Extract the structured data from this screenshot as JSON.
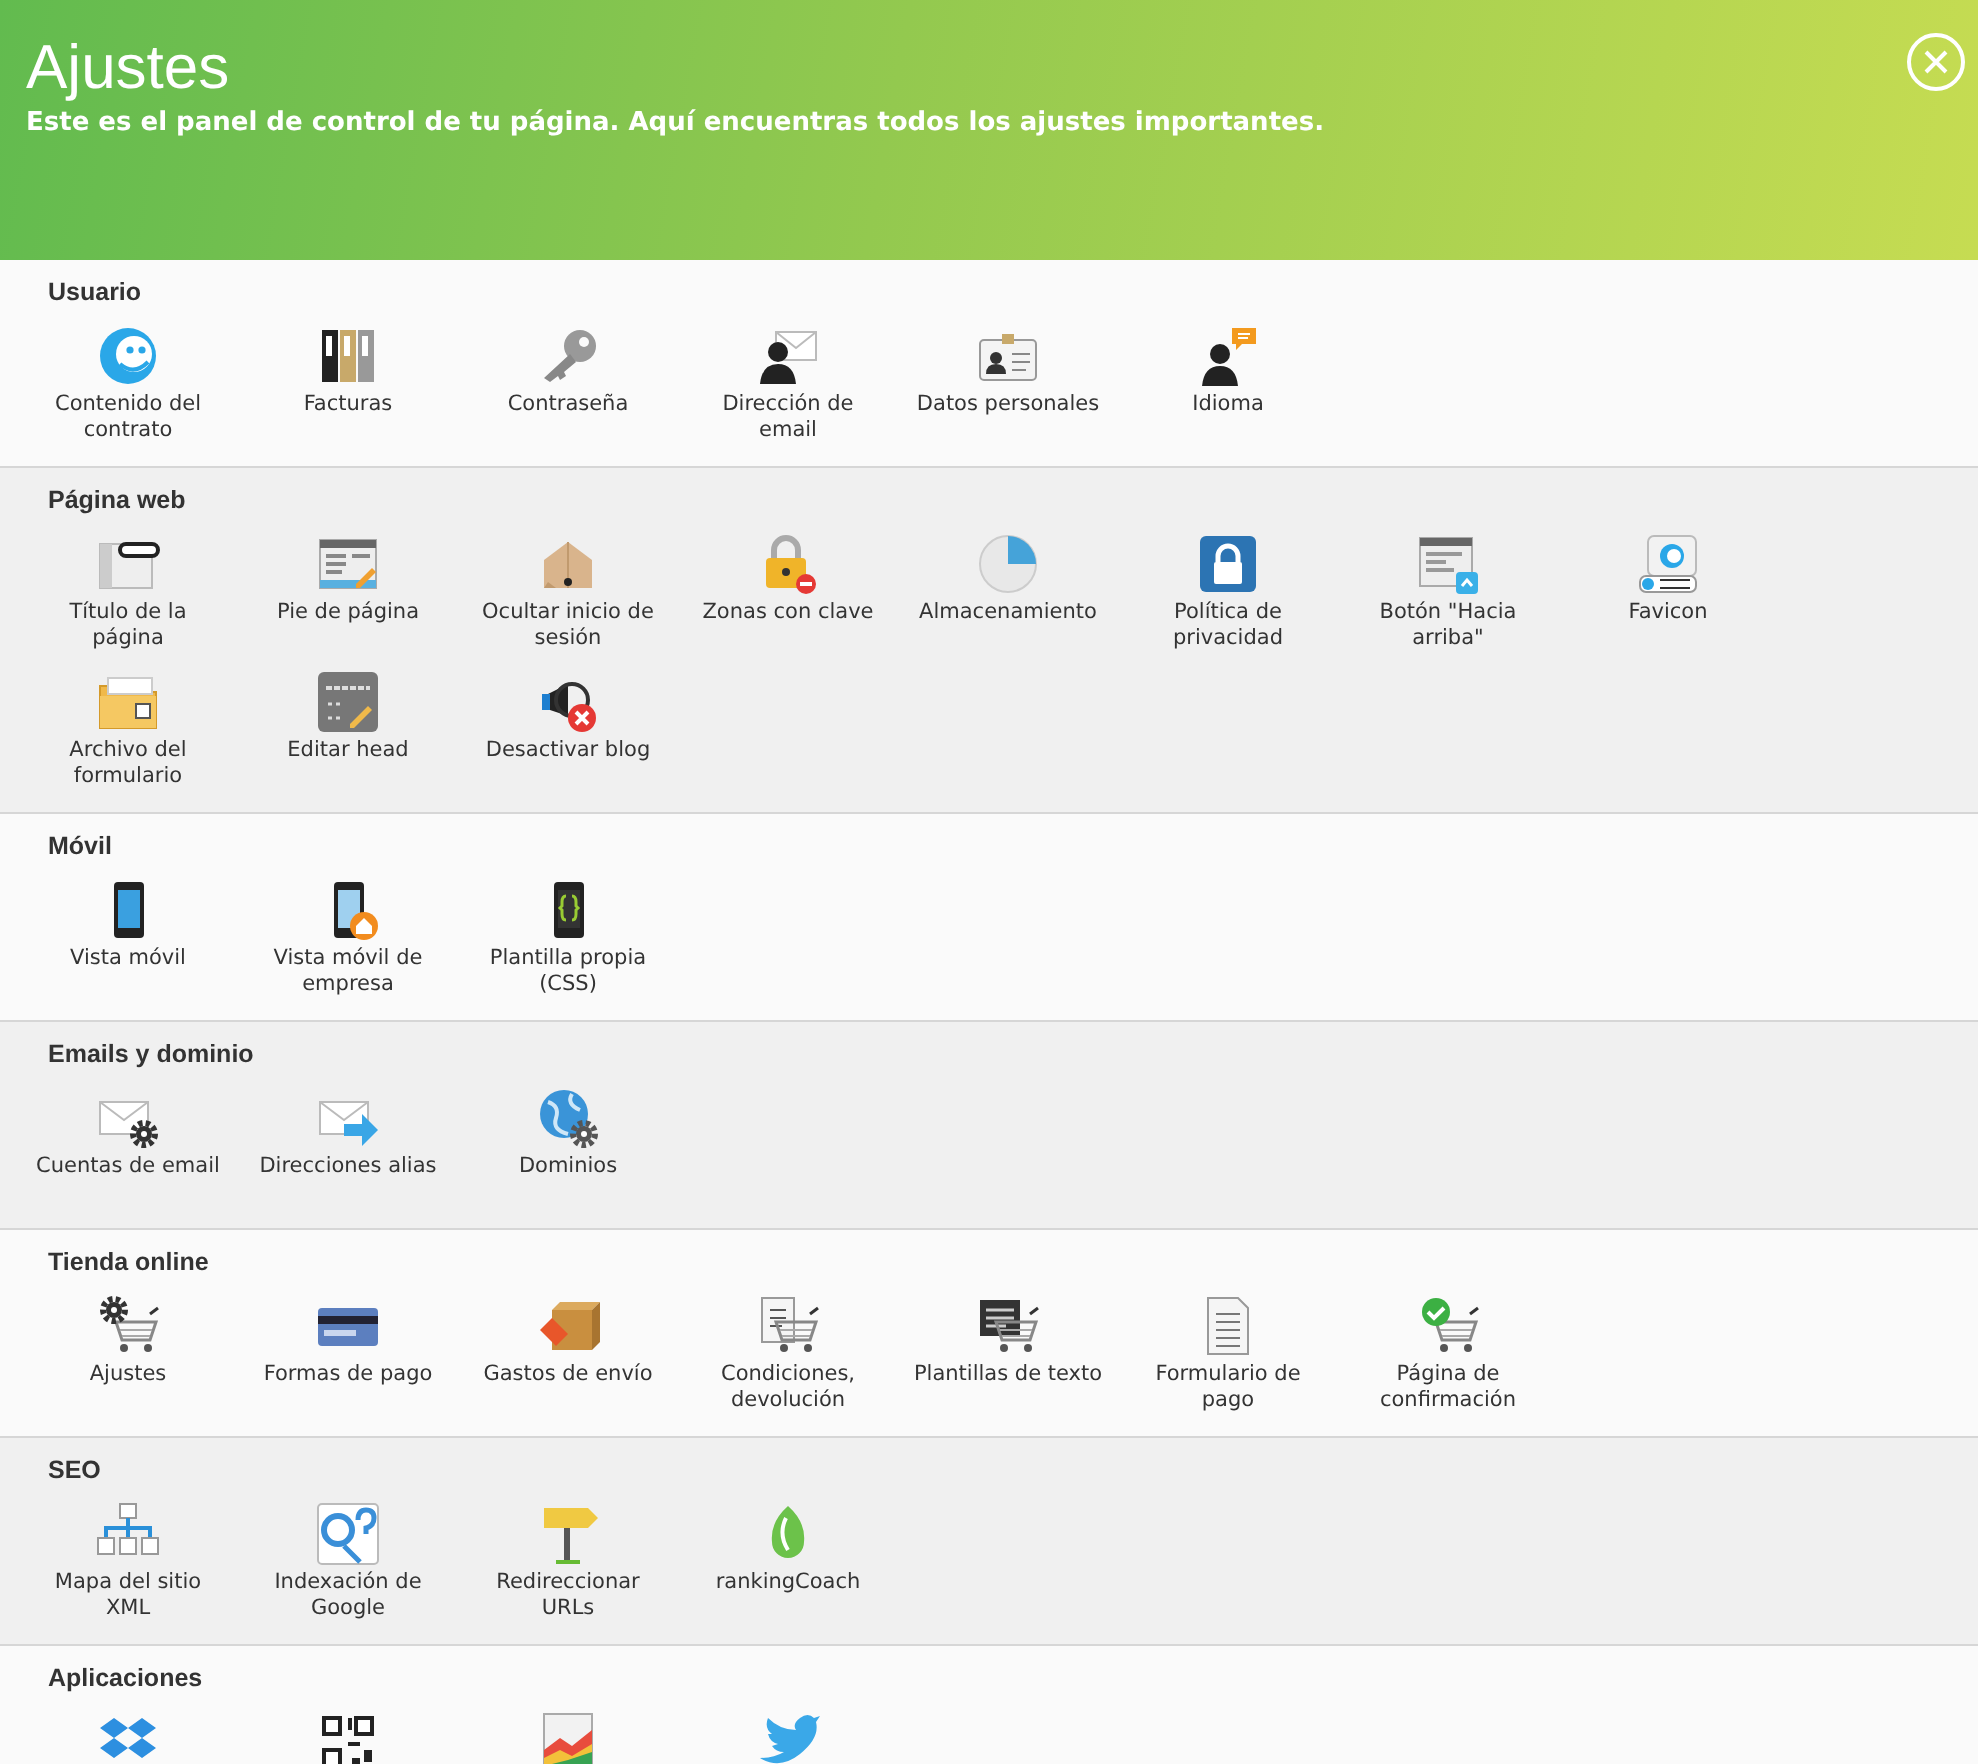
{
  "header": {
    "title": "Ajustes",
    "subtitle": "Este es el panel de control de tu página. Aquí encuentras todos los ajustes importantes."
  },
  "sections": [
    {
      "title": "Usuario",
      "items": [
        {
          "label": "Contenido del contrato"
        },
        {
          "label": "Facturas"
        },
        {
          "label": "Contraseña"
        },
        {
          "label": "Dirección de email"
        },
        {
          "label": "Datos personales"
        },
        {
          "label": "Idioma"
        }
      ]
    },
    {
      "title": "Página web",
      "items": [
        {
          "label": "Título de la página"
        },
        {
          "label": "Pie de página"
        },
        {
          "label": "Ocultar inicio de sesión"
        },
        {
          "label": "Zonas con clave"
        },
        {
          "label": "Almacenamiento"
        },
        {
          "label": "Política de privacidad"
        },
        {
          "label": "Botón \"Hacia arriba\""
        },
        {
          "label": "Favicon"
        },
        {
          "label": "Archivo del formulario"
        },
        {
          "label": "Editar head"
        },
        {
          "label": "Desactivar blog"
        }
      ]
    },
    {
      "title": "Móvil",
      "items": [
        {
          "label": "Vista móvil"
        },
        {
          "label": "Vista móvil de empresa"
        },
        {
          "label": "Plantilla propia (CSS)"
        }
      ]
    },
    {
      "title": "Emails y dominio",
      "items": [
        {
          "label": "Cuentas de email"
        },
        {
          "label": "Direcciones alias"
        },
        {
          "label": "Dominios"
        }
      ]
    },
    {
      "title": "Tienda online",
      "items": [
        {
          "label": "Ajustes"
        },
        {
          "label": "Formas de pago"
        },
        {
          "label": "Gastos de envío"
        },
        {
          "label": "Condiciones, devolución"
        },
        {
          "label": "Plantillas de texto"
        },
        {
          "label": "Formulario de pago"
        },
        {
          "label": "Página de confirmación"
        }
      ]
    },
    {
      "title": "SEO",
      "items": [
        {
          "label": "Mapa del sitio XML"
        },
        {
          "label": "Indexación de Google"
        },
        {
          "label": "Redireccionar URLs"
        },
        {
          "label": "rankingCoach"
        }
      ]
    },
    {
      "title": "Aplicaciones",
      "items": [
        {
          "kind": "icon"
        },
        {
          "kind": "icon"
        },
        {
          "kind": "icon"
        },
        {
          "kind": "icon"
        }
      ]
    }
  ]
}
